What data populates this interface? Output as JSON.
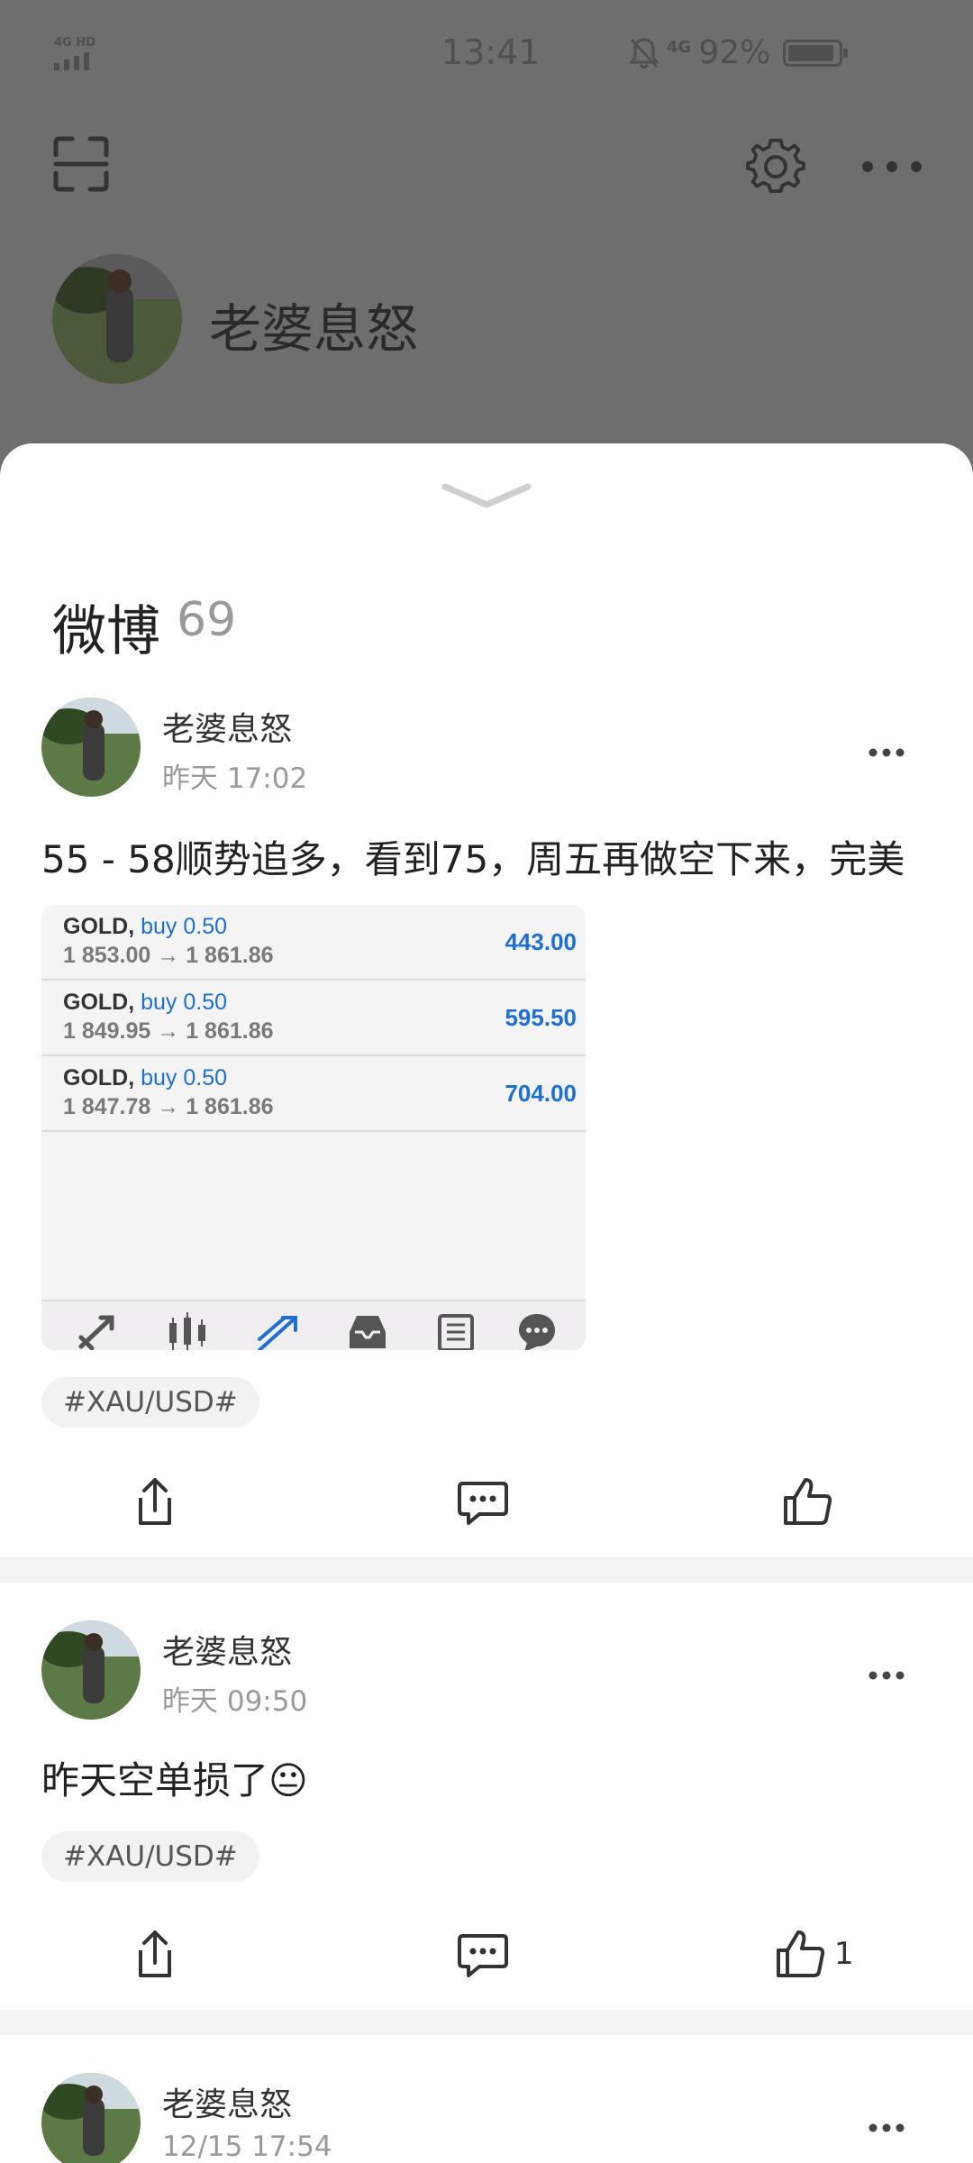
{
  "status_bar": {
    "network": "4G HD",
    "time": "13:41",
    "data_type": "4G",
    "battery": "92%",
    "battery_level": 0.92
  },
  "profile": {
    "name": "老婆息怒"
  },
  "icons": {
    "scan": "scan-icon",
    "settings": "gear-icon",
    "more": "more-icon",
    "collapse": "chevron-down-icon",
    "share": "share-icon",
    "comment": "comment-icon",
    "like": "thumbs-up-icon",
    "mute": "bell-off-icon"
  },
  "sheet": {
    "title": "微博",
    "count": "69"
  },
  "posts": [
    {
      "author": "老婆息怒",
      "time": "昨天 17:02",
      "text": "55 - 58顺势追多，看到75，周五再做空下来，完美",
      "tag": "#XAU/USD#",
      "likes": "",
      "trades": [
        {
          "symbol": "GOLD,",
          "side": "buy 0.50",
          "prices": "1 853.00 → 1 861.86",
          "profit": "443.00"
        },
        {
          "symbol": "GOLD,",
          "side": "buy 0.50",
          "prices": "1 849.95 → 1 861.86",
          "profit": "595.50"
        },
        {
          "symbol": "GOLD,",
          "side": "buy 0.50",
          "prices": "1 847.78 → 1 861.86",
          "profit": "704.00"
        }
      ]
    },
    {
      "author": "老婆息怒",
      "time": "昨天 09:50",
      "text": "昨天空单损了😐",
      "tag": "#XAU/USD#",
      "likes": "1"
    },
    {
      "author": "老婆息怒",
      "time": "12/15 17:54"
    }
  ],
  "colors": {
    "accent": "#1e6fd0",
    "overlay": "#6e6e6e",
    "sheet": "#ffffff"
  }
}
